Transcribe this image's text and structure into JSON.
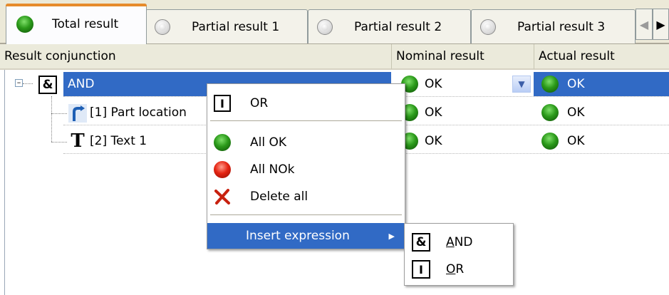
{
  "tabs": [
    {
      "label": "Total result",
      "icon": "green-led-icon"
    },
    {
      "label": "Partial result 1",
      "icon": "radio-icon"
    },
    {
      "label": "Partial result 2",
      "icon": "radio-icon"
    },
    {
      "label": "Partial result 3",
      "icon": "radio-icon"
    }
  ],
  "columns": {
    "conjunction": "Result conjunction",
    "nominal": "Nominal result",
    "actual": "Actual result"
  },
  "rows": [
    {
      "icon": "and-icon",
      "label": "AND",
      "nominal": "OK",
      "actual": "OK"
    },
    {
      "icon": "part-location-icon",
      "label": "[1] Part location",
      "nominal": "OK",
      "actual": "OK"
    },
    {
      "icon": "text-icon",
      "label": "[2] Text 1",
      "nominal": "OK",
      "actual": "OK"
    }
  ],
  "context_menu": {
    "or": "OR",
    "all_ok": "All OK",
    "all_nok": "All NOk",
    "delete_all": "Delete all",
    "insert_expression": "Insert expression"
  },
  "submenu": {
    "and_first": "A",
    "and_rest": "ND",
    "or_first": "O",
    "or_rest": "R"
  },
  "icons": {
    "and_glyph": "&",
    "or_glyph": "I",
    "text_glyph": "T"
  },
  "colors": {
    "selection": "#316ac5",
    "tab_accent": "#e68b2c",
    "ok_green": "#2b9a1a",
    "nok_red": "#e52412"
  }
}
